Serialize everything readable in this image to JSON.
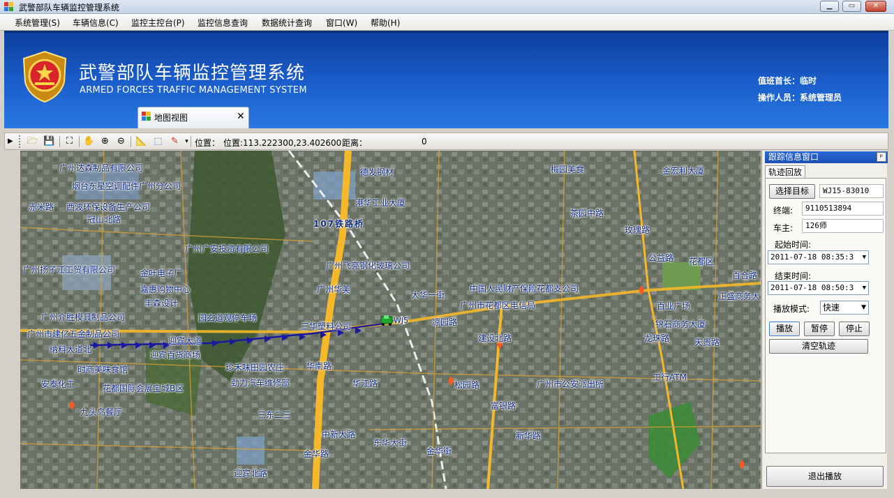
{
  "window": {
    "title": "武警部队车辆监控管理系统",
    "buttons": {
      "minimize": "▁",
      "maximize": "▭",
      "close": "✕"
    }
  },
  "menu": [
    "系统管理(S)",
    "车辆信息(C)",
    "监控主控台(P)",
    "监控信息查询",
    "数据统计查询",
    "窗口(W)",
    "帮助(H)"
  ],
  "banner": {
    "title_cn": "武警部队车辆监控管理系统",
    "title_en": "ARMED FORCES TRAFFIC MANAGEMENT SYSTEM",
    "duty_label": "值班首长：",
    "duty_value": "临时",
    "operator_label": "操作人员：",
    "operator_value": "系统管理员"
  },
  "doc_tab": {
    "label": "地图视图",
    "close": "✕"
  },
  "toolbar": {
    "position_label": "位置：",
    "position_value": "位置:113.222300,23.402600",
    "distance_label": "距离：",
    "distance_value": "0"
  },
  "map": {
    "road_labels": [
      "广州达森制品有限公司",
      "德发钢材",
      "烟台东星空调配件广州分公司",
      "港华工业大厦",
      "赤米路",
      "西波环保设备生产公司",
      "冠山北路",
      "广州广安投资有限公司",
      "广州扬子江工贸有限公司",
      "金叶电子厂",
      "嘉惠购物中心",
      "广州飞亮钢化玻璃公司",
      "广州华美",
      "大华一街",
      "丰森设计",
      "广州介胜模具制品公司",
      "园玄道观停车场",
      "广州市建亿五金制品公司",
      "三华塑料公司",
      "纳料大道北",
      "迎宾大道",
      "迎宾百货商场",
      "时商美味食馆",
      "珍禾味田园农庄",
      "华南路",
      "华江路",
      "劲力汽车维修部",
      "安泰化工",
      "花都国际会展宝城B区",
      "九头鸟餐厅",
      "三东二三",
      "107铁路桥",
      "广州市花都区电信局",
      "中国人民财产保险花都支公司",
      "凉园路",
      "建设北路",
      "松园路",
      "富银路",
      "新华路",
      "梅园美食",
      "金宏利大厦",
      "茶园中路",
      "玫瑰路",
      "公益路",
      "花都区",
      "百合路",
      "正盛商务大",
      "龙珠路",
      "百业广场",
      "天贵路",
      "锦石商务大厦",
      "广州市公安派出所",
      "工行ATM",
      "金华路",
      "东华大街",
      "中新大路",
      "金华街",
      "迎宾北路"
    ],
    "vehicle_label": "WJ5"
  },
  "side_panel": {
    "header": "跟踪信息窗口",
    "pin": "ᵖ",
    "tab": "轨迹回放",
    "select_target": "选择目标",
    "target_value": "WJ15-83010",
    "terminal_label": "终端:",
    "terminal_value": "9110513894",
    "owner_label": "车主:",
    "owner_value": "126师",
    "start_label": "起始时间:",
    "start_value": "2011-07-18 08:35:3",
    "end_label": "结束时间:",
    "end_value": "2011-07-18 08:50:3",
    "mode_label": "播放模式:",
    "mode_value": "快速",
    "play": "播放",
    "pause": "暂停",
    "stop": "停止",
    "clear": "清空轨迹",
    "exit": "退出播放"
  }
}
